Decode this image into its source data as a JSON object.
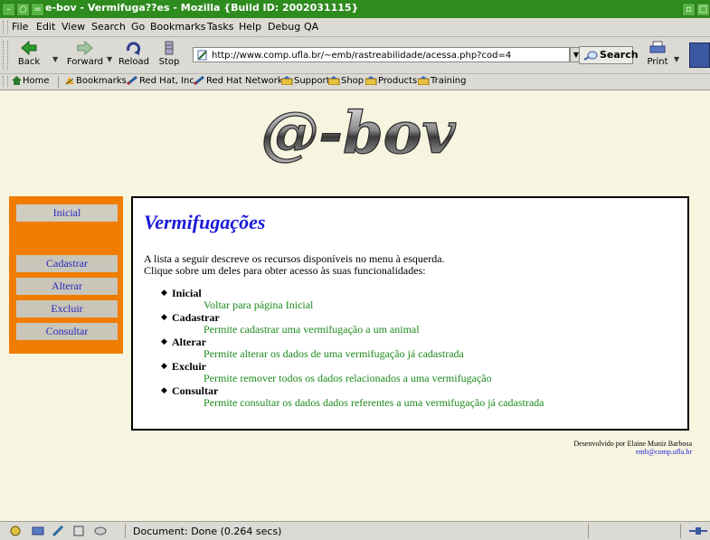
{
  "window": {
    "title": "e-bov - Vermifuga??es - Mozilla {Build ID: 2002031115}"
  },
  "menu": [
    {
      "label": "File"
    },
    {
      "label": "Edit"
    },
    {
      "label": "View"
    },
    {
      "label": "Search"
    },
    {
      "label": "Go"
    },
    {
      "label": "Bookmarks"
    },
    {
      "label": "Tasks"
    },
    {
      "label": "Help"
    },
    {
      "label": "Debug"
    },
    {
      "label": "QA"
    }
  ],
  "toolbar": {
    "back": "Back",
    "forward": "Forward",
    "reload": "Reload",
    "stop": "Stop",
    "url": "http://www.comp.ufla.br/~emb/rastreabilidade/acessa.php?cod=4",
    "search": "Search",
    "print": "Print"
  },
  "personal_toolbar": [
    {
      "label": "Home",
      "icon": "home-icon"
    },
    {
      "label": "Bookmarks",
      "icon": "bookmarks-icon"
    },
    {
      "label": "Red Hat, Inc.",
      "icon": "redhat-icon"
    },
    {
      "label": "Red Hat Network",
      "icon": "redhat-icon"
    },
    {
      "label": "Support",
      "icon": "folder-icon"
    },
    {
      "label": "Shop",
      "icon": "folder-icon"
    },
    {
      "label": "Products",
      "icon": "folder-icon"
    },
    {
      "label": "Training",
      "icon": "folder-icon"
    }
  ],
  "page": {
    "logo_text": "@-bov",
    "sidebar": {
      "items": [
        {
          "label": "Inicial"
        },
        {
          "label": "Cadastrar"
        },
        {
          "label": "Alterar"
        },
        {
          "label": "Excluir"
        },
        {
          "label": "Consultar"
        }
      ]
    },
    "heading": "Vermifugações",
    "intro_line1": "A lista a seguir descreve os recursos disponíveis no menu à esquerda.",
    "intro_line2": "Clique sobre um deles para obter acesso às suas funcionalidades:",
    "features": [
      {
        "term": "Inicial",
        "desc": "Voltar para página Inicial"
      },
      {
        "term": "Cadastrar",
        "desc": "Permite cadastrar uma vermifugação a um animal"
      },
      {
        "term": "Alterar",
        "desc": "Permite alterar os dados de uma vermifugação já cadastrada"
      },
      {
        "term": "Excluir",
        "desc": "Permite remover todos os dados relacionados a uma vermifugação"
      },
      {
        "term": "Consultar",
        "desc": "Permite consultar os dados dados referentes a uma vermifugação já cadastrada"
      }
    ],
    "credit_line": "Desenvolvido por Elaine Muniz Barbosa",
    "credit_email": "emb@comp.ufla.br"
  },
  "status": {
    "text": "Document: Done (0.264 secs)"
  },
  "colors": {
    "sidebar": "#f07c00",
    "heading": "#1a1ad8",
    "description": "#1c8a1c",
    "titlebar": "#2e8b1e"
  }
}
